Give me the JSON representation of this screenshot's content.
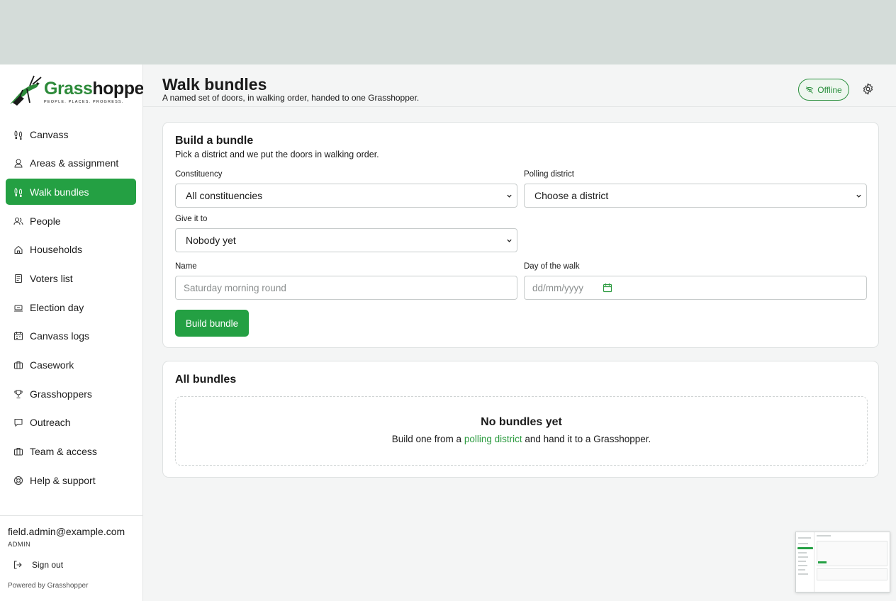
{
  "brand": {
    "name_part1": "Grass",
    "name_part2": "hopper",
    "tagline": "PEOPLE. PLACES. PROGRESS."
  },
  "sidebar": {
    "items": [
      {
        "label": "Canvass",
        "icon": "footsteps-icon"
      },
      {
        "label": "Areas & assignment",
        "icon": "map-pin-person-icon"
      },
      {
        "label": "Walk bundles",
        "icon": "footsteps-icon",
        "active": true
      },
      {
        "label": "People",
        "icon": "people-icon"
      },
      {
        "label": "Households",
        "icon": "house-icon"
      },
      {
        "label": "Voters list",
        "icon": "document-list-icon"
      },
      {
        "label": "Election day",
        "icon": "ballot-box-icon"
      },
      {
        "label": "Canvass logs",
        "icon": "calendar-log-icon"
      },
      {
        "label": "Casework",
        "icon": "briefcase-icon"
      },
      {
        "label": "Grasshoppers",
        "icon": "trophy-icon"
      },
      {
        "label": "Outreach",
        "icon": "chat-bubble-icon"
      },
      {
        "label": "Team & access",
        "icon": "briefcase-icon"
      },
      {
        "label": "Help & support",
        "icon": "lifebuoy-icon"
      }
    ],
    "user": {
      "email": "field.admin@example.com",
      "role": "ADMIN"
    },
    "signout_label": "Sign out",
    "powered_by": "Powered by Grasshopper"
  },
  "header": {
    "title": "Walk bundles",
    "subtitle": "A named set of doors, in walking order, handed to one Grasshopper.",
    "status_label": "Offline"
  },
  "build_card": {
    "title": "Build a bundle",
    "subtitle": "Pick a district and we put the doors in walking order.",
    "constituency_label": "Constituency",
    "constituency_value": "All constituencies",
    "district_label": "Polling district",
    "district_value": "Choose a district",
    "assignee_label": "Give it to",
    "assignee_value": "Nobody yet",
    "name_label": "Name",
    "name_placeholder": "Saturday morning round",
    "date_label": "Day of the walk",
    "date_placeholder": "dd/mm/yyyy",
    "build_button": "Build bundle"
  },
  "bundles_card": {
    "title": "All bundles",
    "empty_title": "No bundles yet",
    "empty_text_before": "Build one from a ",
    "empty_link": "polling district",
    "empty_text_after": " and hand it to a Grasshopper."
  },
  "colors": {
    "accent": "#24a043",
    "link": "#2a9a3e",
    "top_band": "#d4dcd9"
  }
}
